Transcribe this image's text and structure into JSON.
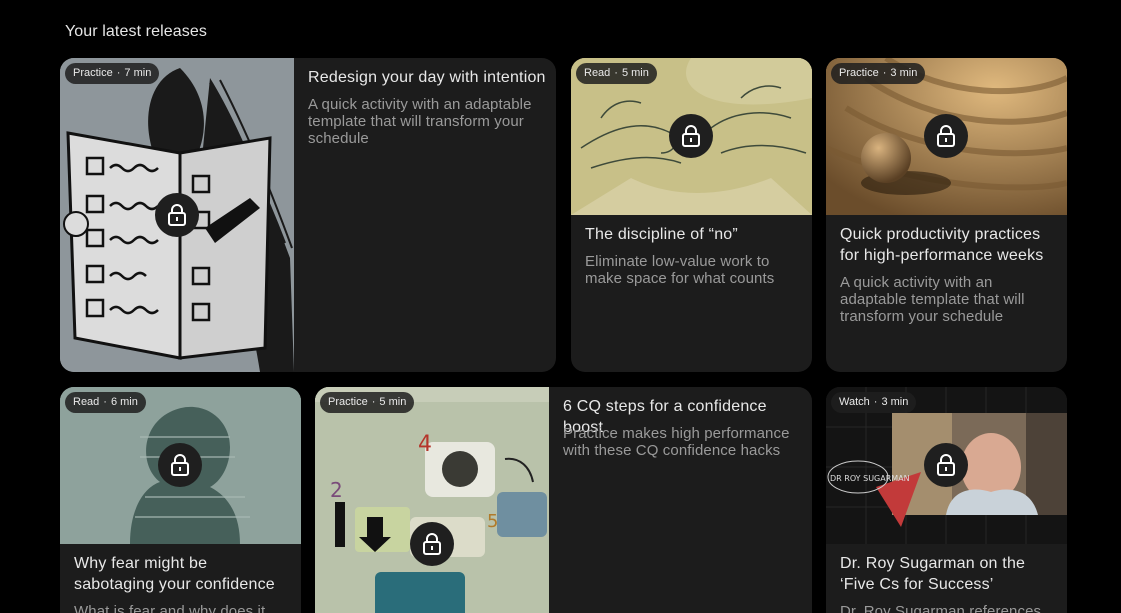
{
  "section": {
    "title": "Your latest releases"
  },
  "cards": [
    {
      "type": "Practice",
      "duration": "7 min",
      "title": "Redesign your day with intention",
      "description": "A quick activity with an adaptable template that will transform your schedule",
      "locked": true
    },
    {
      "type": "Read",
      "duration": "5 min",
      "title": "The discipline of “no”",
      "description": "Eliminate low-value work to make space for what counts",
      "locked": true
    },
    {
      "type": "Practice",
      "duration": "3 min",
      "title": "Quick productivity practices for high-performance weeks",
      "description": "A quick activity with an adaptable template that will transform your schedule",
      "locked": true
    },
    {
      "type": "Read",
      "duration": "6 min",
      "title": "Why fear might be sabotaging your confidence",
      "description": "What is fear and why does it",
      "locked": true
    },
    {
      "type": "Practice",
      "duration": "5 min",
      "title": "6 CQ steps for a confidence boost",
      "description": "Practice makes high performance with these CQ confidence hacks",
      "locked": true
    },
    {
      "type": "Watch",
      "duration": "3 min",
      "title": "Dr. Roy Sugarman on the ‘Five Cs for Success’",
      "description": "Dr. Roy Sugarman references",
      "locked": true,
      "video_caption": "DR ROY SUGARMAN"
    }
  ],
  "icons": {
    "lock": "padlock-icon"
  }
}
